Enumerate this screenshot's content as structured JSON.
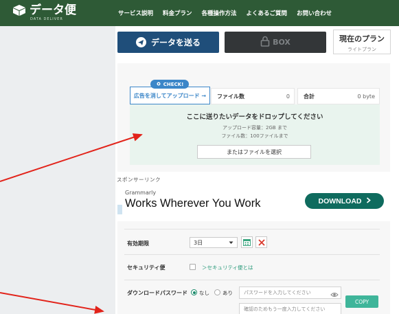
{
  "header": {
    "logo_text": "データ便",
    "logo_sub": "DATA DELIVER",
    "nav": [
      "サービス説明",
      "料金プラン",
      "各種操作方法",
      "よくあるご質問",
      "お問い合わせ"
    ]
  },
  "actions": {
    "send_label": "データを送る",
    "box_label": "BOX",
    "plan_title": "現在のプラン",
    "plan_name": "ライトプラン"
  },
  "upload": {
    "check_badge": "CHECK!",
    "ad_free_upload": "広告を消してアップロード →",
    "file_count_label": "ファイル数",
    "file_count_value": "0",
    "total_label": "合計",
    "total_value": "0 byte",
    "drop_title": "ここに送りたいデータをドロップしてください",
    "capacity_info": "アップロード容量：2GB まで",
    "file_limit_info": "ファイル数：100ファイルまで",
    "select_button": "またはファイルを選択"
  },
  "sponsored": {
    "label": "スポンサーリンク",
    "brand": "Grammarly",
    "headline": "Works Wherever You Work",
    "cta": "DOWNLOAD"
  },
  "form": {
    "expiry_label": "有効期限",
    "expiry_value": "3日",
    "security_label": "セキュリティ便",
    "security_link": "＞セキュリティ便とは",
    "password_label": "ダウンロードパスワード",
    "password_none": "なし",
    "password_yes": "あり",
    "password_placeholder": "パスワードを入力してください",
    "password_confirm_placeholder": "確認のためもう一度入力してください",
    "copy_button": "COPY"
  },
  "colors": {
    "header_bg": "#2e5a36",
    "send_button": "#1f4e7a",
    "dropzone": "#e9f4ee",
    "accent_blue": "#3b86c8",
    "download_cta": "#0f6b5e",
    "copy_button": "#3fb59a",
    "annotation_arrow": "#e2231a"
  }
}
